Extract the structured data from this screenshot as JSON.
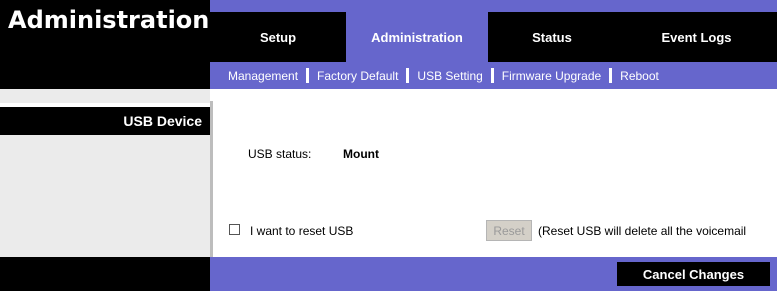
{
  "header": {
    "title": "Administration",
    "tabs": [
      {
        "label": "Setup",
        "active": false
      },
      {
        "label": "Administration",
        "active": true
      },
      {
        "label": "Status",
        "active": false
      },
      {
        "label": "Event Logs",
        "active": false
      }
    ],
    "subnav": [
      "Management",
      "Factory Default",
      "USB Setting",
      "Firmware Upgrade",
      "Reboot"
    ]
  },
  "sidebar": {
    "section_label": "USB Device"
  },
  "content": {
    "usb_status_label": "USB status:",
    "usb_status_value": "Mount",
    "reset_checkbox_label": "I want to reset USB",
    "reset_checkbox_checked": false,
    "reset_button_label": "Reset",
    "reset_button_enabled": false,
    "reset_note": "(Reset USB will delete all the voicemail"
  },
  "footer": {
    "cancel_label": "Cancel Changes"
  },
  "colors": {
    "accent": "#6666cc",
    "header_bg": "#000000",
    "sidebar_bg": "#ebebeb"
  }
}
